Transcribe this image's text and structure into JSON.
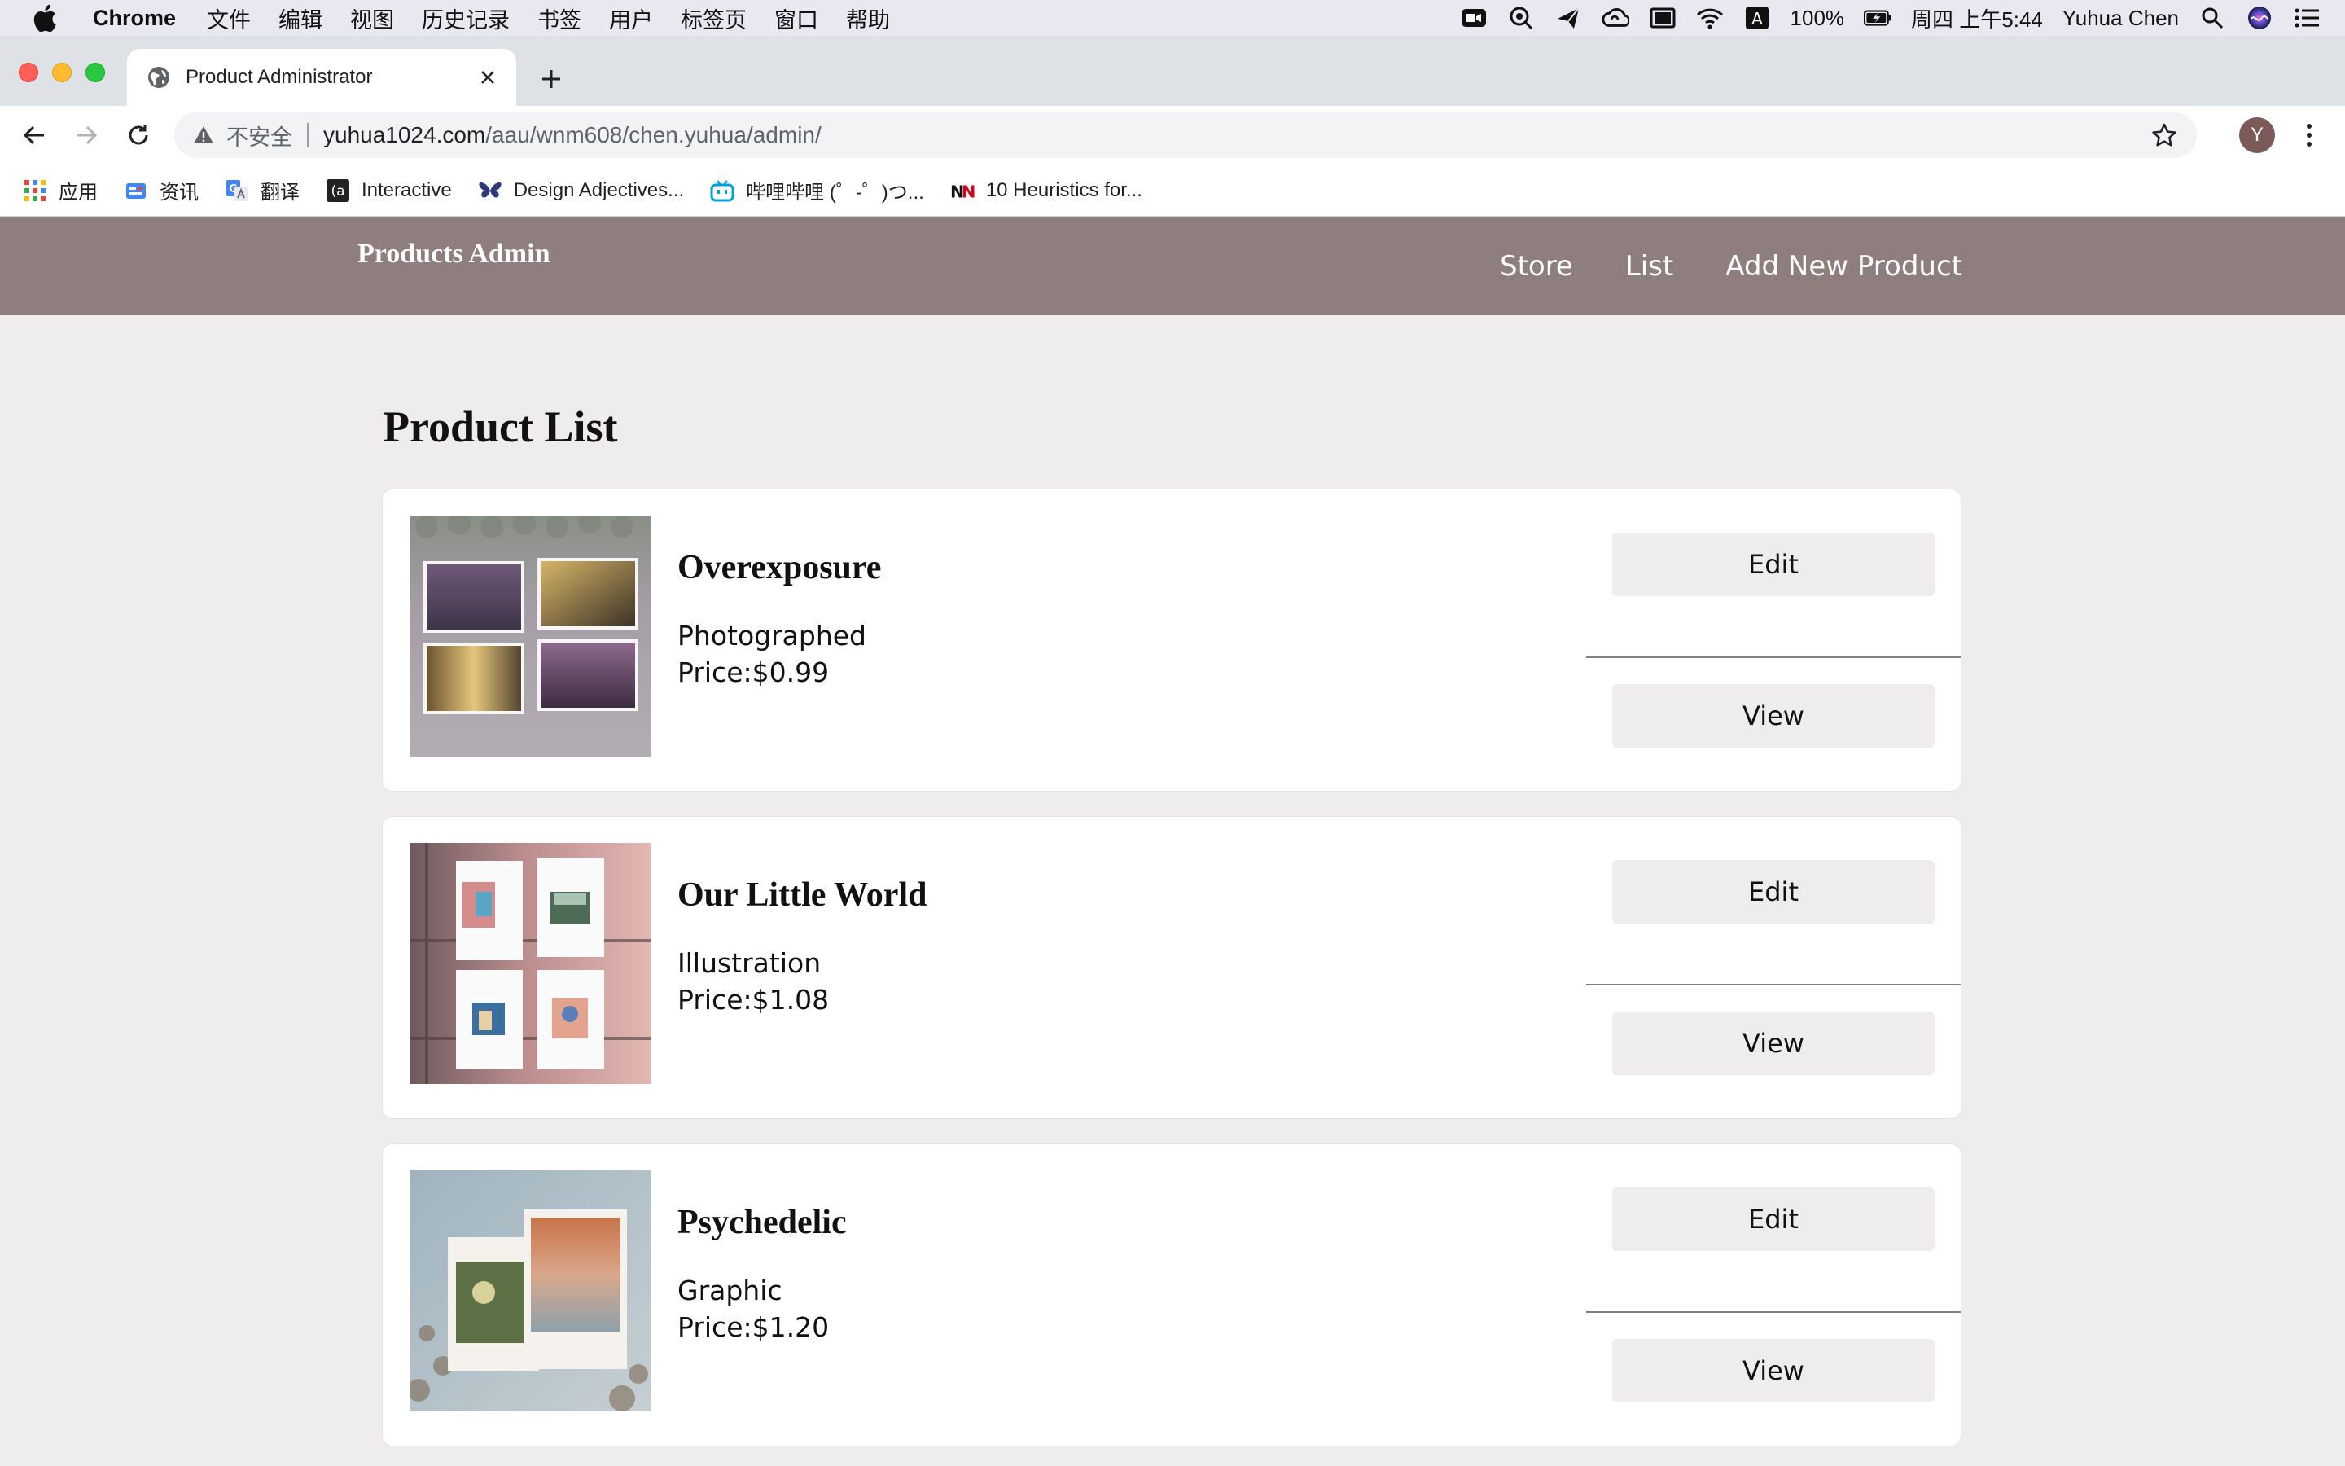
{
  "menubar": {
    "app": "Chrome",
    "items": [
      "文件",
      "编辑",
      "视图",
      "历史记录",
      "书签",
      "用户",
      "标签页",
      "窗口",
      "帮助"
    ],
    "battery": "100%",
    "clock": "周四 上午5:44",
    "user": "Yuhua Chen",
    "input_indicator": "A"
  },
  "browser": {
    "tab_title": "Product Administrator",
    "insecure_label": "不安全",
    "url_host": "yuhua1024.com",
    "url_path": "/aau/wnm608/chen.yuhua/admin/",
    "profile_initial": "Y"
  },
  "bookmarks": [
    {
      "label": "应用",
      "icon": "apps-grid-icon"
    },
    {
      "label": "资讯",
      "icon": "news-icon"
    },
    {
      "label": "翻译",
      "icon": "translate-icon"
    },
    {
      "label": "Interactive",
      "icon": "interactive-icon"
    },
    {
      "label": "Design Adjectives...",
      "icon": "butterfly-icon"
    },
    {
      "label": "哔哩哔哩 (゜-゜)つ...",
      "icon": "bilibili-icon"
    },
    {
      "label": "10 Heuristics for...",
      "icon": "nn-icon"
    }
  ],
  "site": {
    "brand": "Products Admin",
    "nav": [
      "Store",
      "List",
      "Add New Product"
    ],
    "header_color": "#8e7f7e"
  },
  "page": {
    "title": "Product List"
  },
  "products": [
    {
      "name": "Overexposure",
      "category": "Photographed",
      "price": "Price:$0.99",
      "edit_label": "Edit",
      "view_label": "View"
    },
    {
      "name": "Our Little World",
      "category": "Illustration",
      "price": "Price:$1.08",
      "edit_label": "Edit",
      "view_label": "View"
    },
    {
      "name": "Psychedelic",
      "category": "Graphic",
      "price": "Price:$1.20",
      "edit_label": "Edit",
      "view_label": "View"
    }
  ]
}
